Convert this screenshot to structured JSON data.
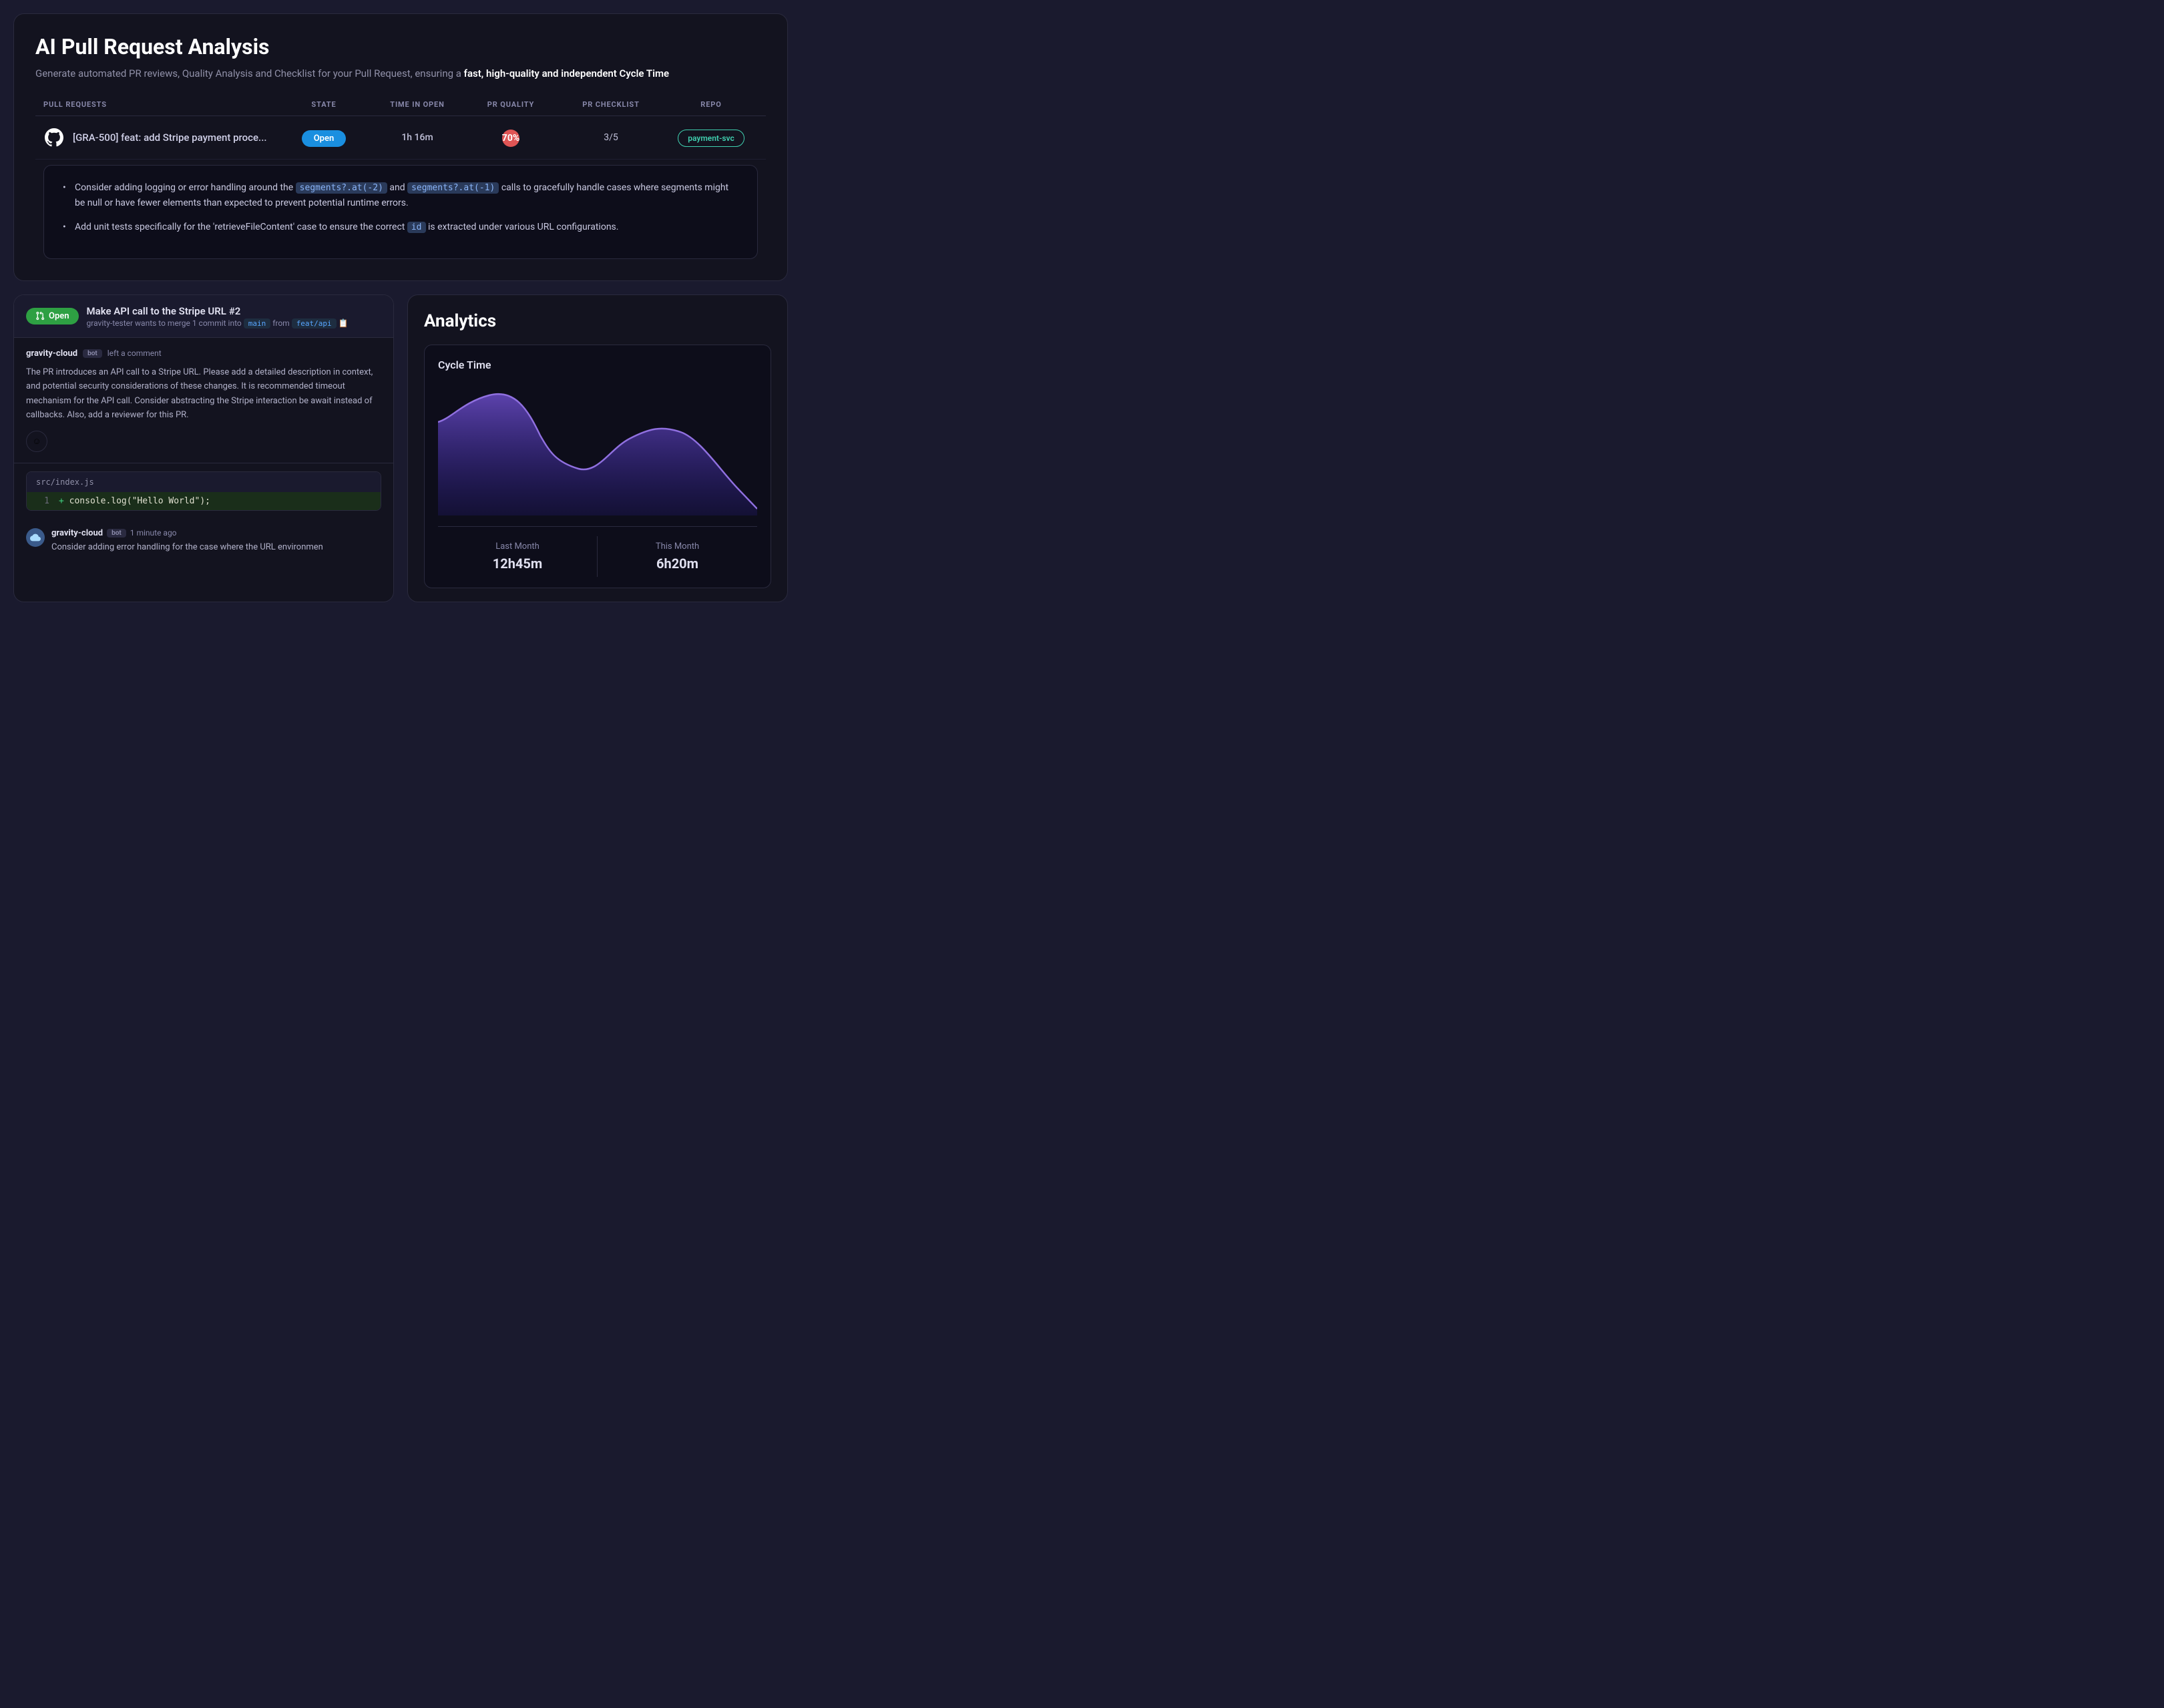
{
  "topPanel": {
    "title": "AI Pull Request Analysis",
    "subtitle_plain": "Generate automated PR reviews, Quality Analysis and Checklist for your Pull Request, ensuring a ",
    "subtitle_bold": "fast, high-quality and independent Cycle Time",
    "tableHeaders": {
      "pullRequests": "PULL REQUESTS",
      "state": "STATE",
      "timeInOpen": "TIME IN OPEN",
      "prQuality": "PR QUALITY",
      "prChecklist": "PR CHECKLIST",
      "repo": "REPO"
    },
    "prRow": {
      "title": "[GRA-500] feat: add Stripe payment proce...",
      "state": "Open",
      "timeInOpen": "1h 16m",
      "prQuality": "70%",
      "prChecklist": "3/5",
      "repo": "payment-svc"
    },
    "aiComments": [
      {
        "text_before": "Consider adding logging or error handling around the ",
        "highlight1": "segments?.at(-2)",
        "text_middle": " and ",
        "highlight2": "segments?.at(-1)",
        "text_after": " calls to gracefully handle cases where segments might be null or have fewer elements than expected to prevent potential runtime errors."
      },
      {
        "text_before": "Add unit tests specifically for the 'retrieveFileContent' case to ensure the correct ",
        "highlight_id": "id",
        "text_after": " is extracted under various URL configurations."
      }
    ]
  },
  "prDetail": {
    "badge": "Open",
    "title": "Make API call to the Stripe URL",
    "prNumber": "#2",
    "subtitle_before": "gravity-tester wants to merge 1 commit into ",
    "branch_main": "main",
    "subtitle_middle": " from ",
    "branch_feat": "feat/api",
    "commenter": "gravity-cloud",
    "bot_label": "bot",
    "comment_action": "left a comment",
    "comment_text": "The PR introduces an API call to a Stripe URL. Please add a detailed description in context, and potential security considerations of these changes. It is recommended timeout mechanism for the API call. Consider abstracting the Stripe interaction be await instead of callbacks. Also, add a reviewer for this PR.",
    "emoji_icon": "☺",
    "code_filename": "src/index.js",
    "code_line_num": "1",
    "code_line_content": "+ console.log(\"Hello World\");",
    "bot2_name": "gravity-cloud",
    "bot2_badge": "bot",
    "bot2_time": "1 minute ago",
    "bot2_comment": "Consider adding error handling for the case where the URL environmen"
  },
  "analytics": {
    "title": "Analytics",
    "chartTitle": "Cycle Time",
    "lastMonthLabel": "Last Month",
    "lastMonthValue": "12h45m",
    "thisMonthLabel": "This Month",
    "thisMonthValue": "6h20m",
    "chart": {
      "accentColor": "#6040c0",
      "fillColor": "#4020a0"
    }
  }
}
